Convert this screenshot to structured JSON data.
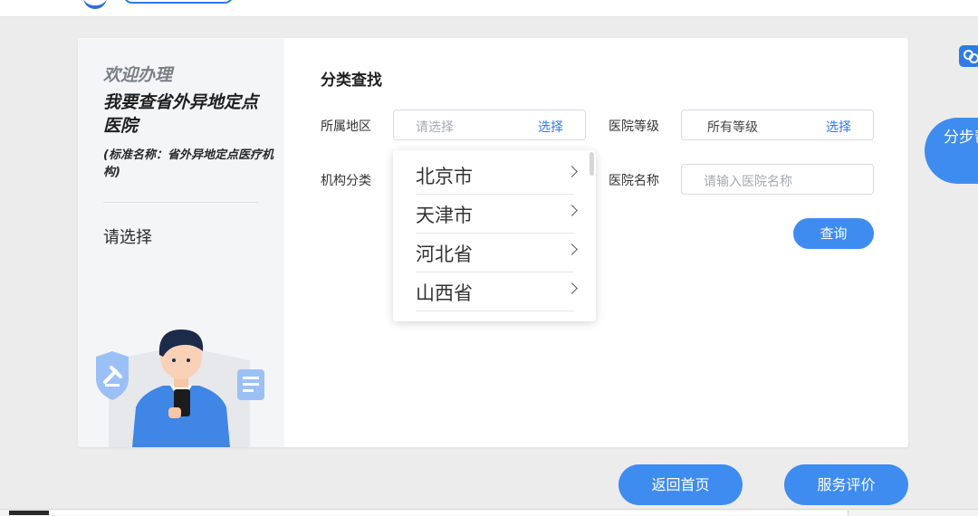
{
  "sidebar": {
    "welcome": "欢迎办理",
    "title": "我要查省外异地定点医院",
    "standard_name": "(标准名称：省外异地定点医疗机构)",
    "prompt": "请选择"
  },
  "search": {
    "section_title": "分类查找",
    "region": {
      "label": "所属地区",
      "placeholder": "请选择",
      "action": "选择"
    },
    "level": {
      "label": "医院等级",
      "value": "所有等级",
      "action": "选择"
    },
    "category": {
      "label": "机构分类"
    },
    "hospital_name": {
      "label": "医院名称",
      "placeholder": "请输入医院名称"
    },
    "query_button": "查询"
  },
  "region_dropdown": {
    "items": [
      {
        "label": "北京市"
      },
      {
        "label": "天津市"
      },
      {
        "label": "河北省"
      },
      {
        "label": "山西省"
      }
    ]
  },
  "footer": {
    "home_button": "返回首页",
    "evaluate_button": "服务评价"
  },
  "floating": {
    "help_text": "分步帮助",
    "icon": "link-icon"
  },
  "colors": {
    "primary": "#3f8cf0",
    "link": "#2f7ae5",
    "page_bg": "#ececec",
    "sidebar_bg": "#f4f5f7"
  }
}
